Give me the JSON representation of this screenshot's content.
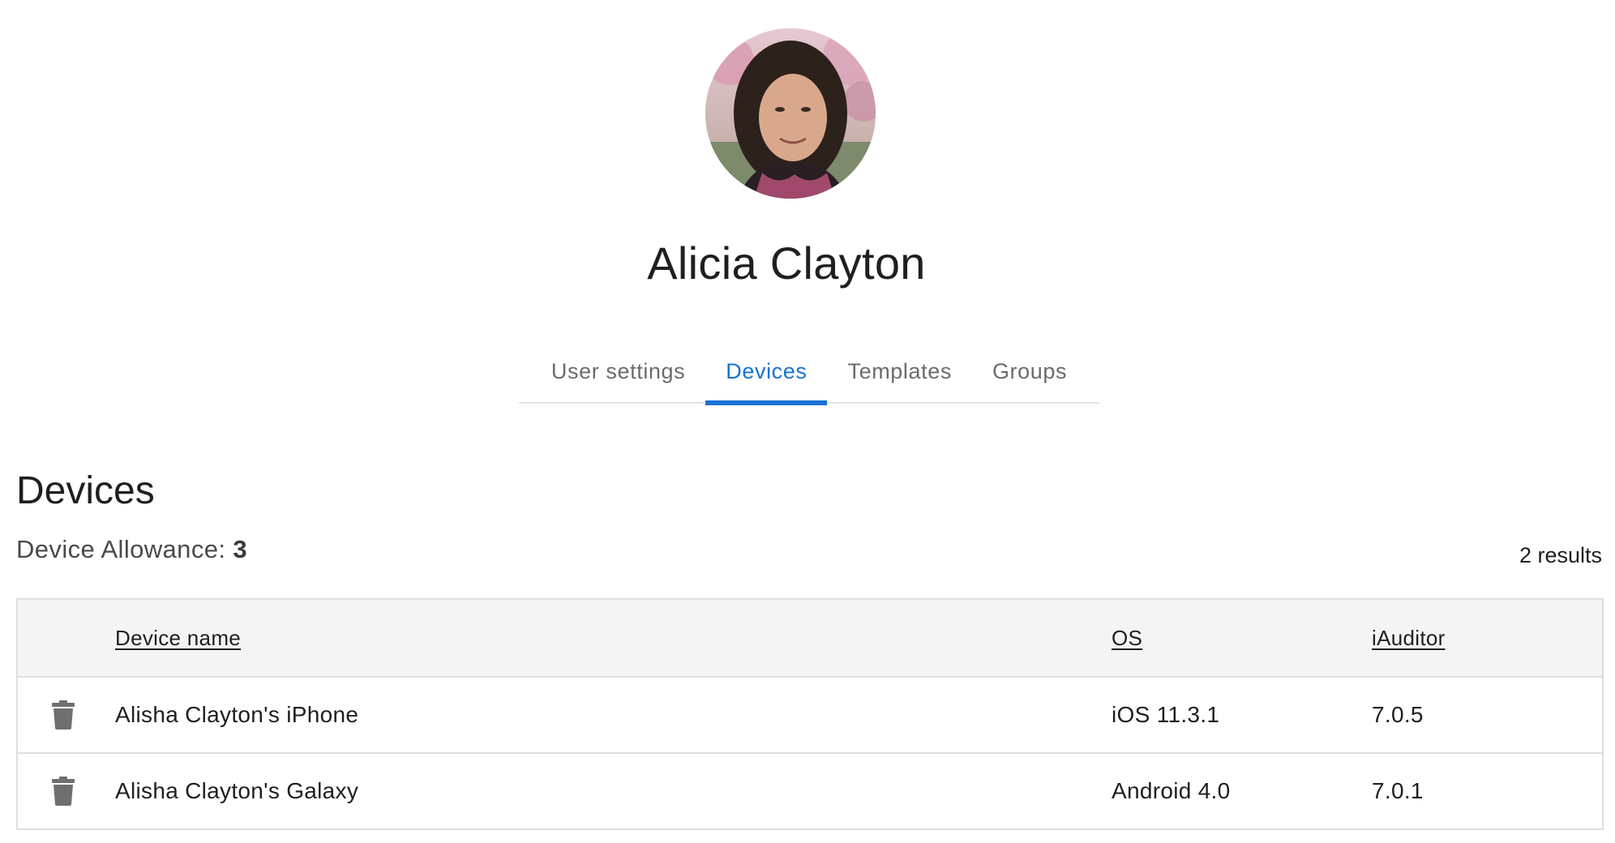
{
  "user": {
    "name": "Alicia Clayton"
  },
  "tabs": [
    {
      "label": "User settings",
      "active": false
    },
    {
      "label": "Devices",
      "active": true
    },
    {
      "label": "Templates",
      "active": false
    },
    {
      "label": "Groups",
      "active": false
    }
  ],
  "devices_section": {
    "title": "Devices",
    "allowance_label": "Device Allowance:",
    "allowance_value": "3",
    "results_count": "2 results"
  },
  "table": {
    "columns": [
      "Device name",
      "OS",
      "iAuditor"
    ],
    "rows": [
      {
        "device_name": "Alisha Clayton's iPhone",
        "os": "iOS 11.3.1",
        "iauditor": "7.0.5",
        "action_icon": "trash-icon"
      },
      {
        "device_name": "Alisha Clayton's Galaxy",
        "os": "Android 4.0",
        "iauditor": "7.0.1",
        "action_icon": "trash-icon"
      }
    ]
  },
  "colors": {
    "accent": "#1972d4",
    "tab_inactive": "#6b6b6b",
    "table_header_bg": "#f4f4f4",
    "border": "#dedede",
    "icon": "#6f6f6f"
  }
}
